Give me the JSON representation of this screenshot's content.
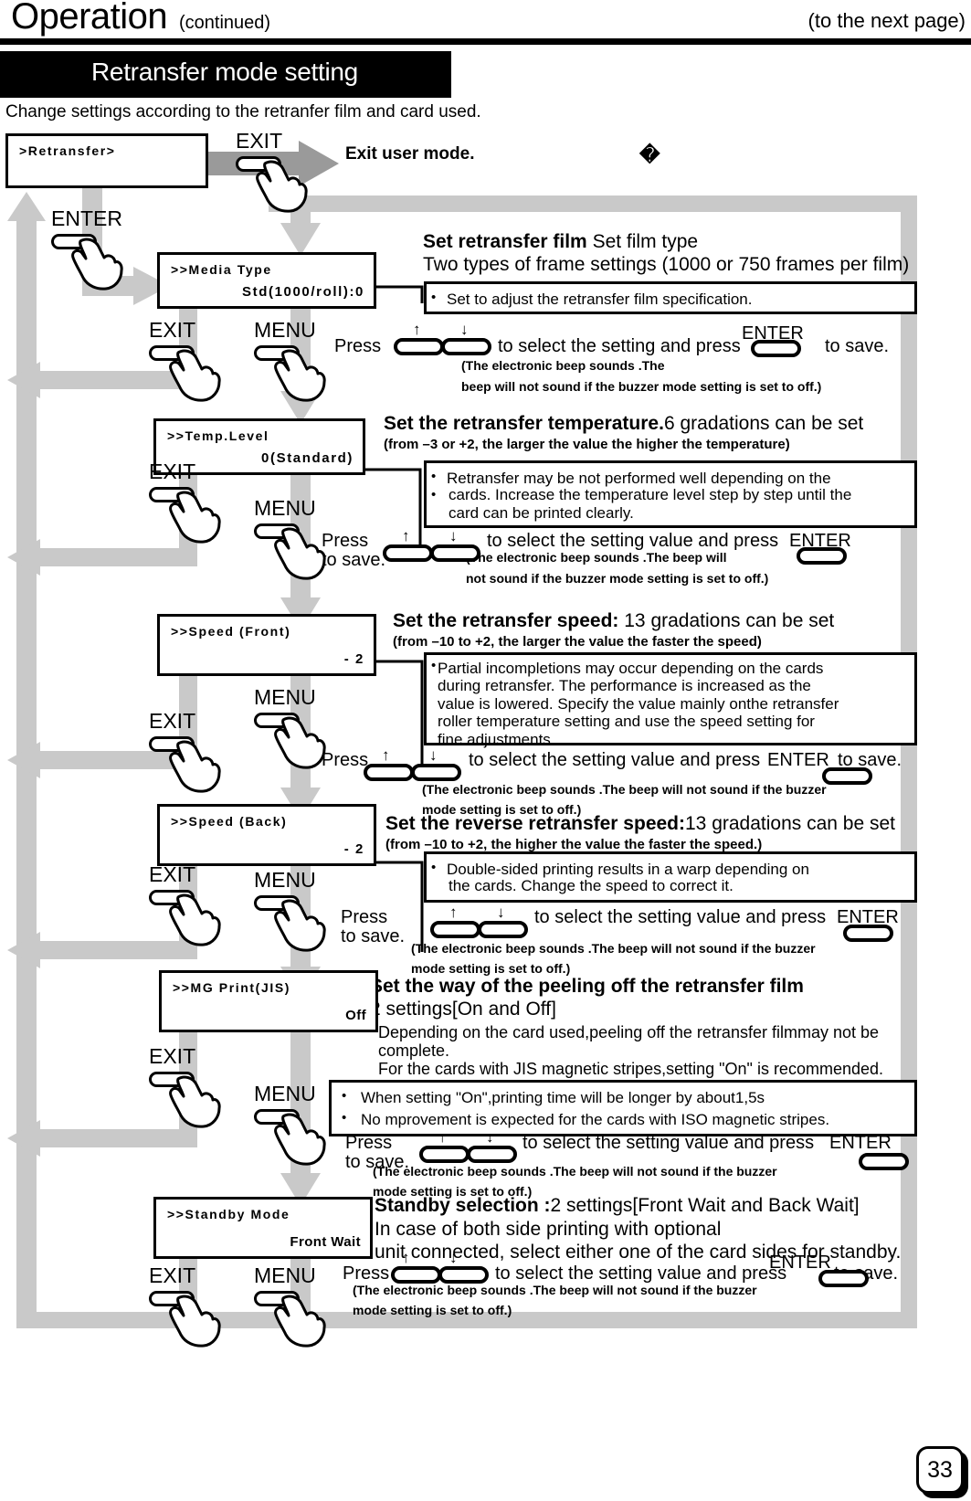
{
  "header": {
    "title": "Operation",
    "continued": "(continued)",
    "next_page": "(to the next page)",
    "section_band": "Retransfer mode setting",
    "intro": "Change settings according to the retranfer film and card used.",
    "unknown_glyph": "�"
  },
  "buttons": {
    "exit": "EXIT",
    "menu": "MENU",
    "enter": "ENTER",
    "up_arrow": "↑",
    "down_arrow": "↓"
  },
  "exit_flow": {
    "lcd_line1": ">Retransfer>",
    "label": "Exit user mode.",
    "exit_label": "EXIT"
  },
  "common": {
    "beep_full_1": "(The electronic beep sounds .The",
    "beep_full_2": "beep will not sound if the buzzer mode setting is set to off.)",
    "beep_a1": "(The electronic beep sounds .The beep will",
    "beep_a2": "not sound if the buzzer mode setting is set to off.)",
    "beep_b1": "(The electronic beep sounds .The beep will not sound if the buzzer",
    "beep_b2": "mode setting is set to off.)",
    "press": "Press",
    "to_save": "to save.",
    "select_setting_and_press": "to select the setting and press",
    "select_value_and_press": "to select the setting value and press"
  },
  "steps": [
    {
      "id": "media-type",
      "lcd_line1": ">>Media Type",
      "lcd_line2": "Std(1000/roll):0",
      "title_bold": "Set retransfer film",
      "title_rest": " Set film type",
      "title_line2": "Two types of frame settings (1000 or 750 frames per film)",
      "notes": [
        "Set to adjust the retransfer film specification."
      ]
    },
    {
      "id": "temp-level",
      "lcd_line1": ">>Temp.Level",
      "lcd_line2": "0(Standard)",
      "title_bold": "Set the retransfer temperature.",
      "title_rest": "6 gradations can be set",
      "title_line2": "(from –3 or +2, the larger the value the higher the temperature)",
      "notes": [
        "Retransfer may be not performed well depending on the",
        "cards.  Increase the temperature level step by step until the",
        "card can be printed clearly."
      ]
    },
    {
      "id": "speed-front",
      "lcd_line1": ">>Speed (Front)",
      "lcd_line2": "- 2",
      "title_bold": "Set the retransfer speed:",
      "title_rest": " 13 gradations can be set",
      "title_line2": "(from –10 to +2, the larger the value the faster the speed)",
      "notes": [
        "Partial incompletions may occur depending on the cards",
        "during retransfer. The performance is increased as the",
        "value is lowered.  Specify the value mainly onthe retransfer",
        "roller temperature setting and use the speed setting for",
        "fine adjustments."
      ]
    },
    {
      "id": "speed-back",
      "lcd_line1": ">>Speed (Back)",
      "lcd_line2": "- 2",
      "title_bold": "Set the reverse retransfer speed:",
      "title_rest": "13 gradations can be set",
      "title_line2": "(from –10 to +2, the higher the value the faster the speed.)",
      "notes": [
        "Double-sided printing results in a warp depending on",
        "the cards.  Change the speed to correct it."
      ]
    },
    {
      "id": "mg-print",
      "lcd_line1": ">>MG Print(JIS)",
      "lcd_line2": "Off",
      "title_bold": "Set the way of the peeling off the retransfer film",
      "title_rest": "",
      "title_line2": "2 settings[On and Off]",
      "body": [
        "Depending on the card used,peeling off the retransfer filmmay not be",
        "complete.",
        "For the cards with JIS magnetic stripes,setting \"On\" is recommended."
      ],
      "notes": [
        "When setting \"On\",printing time will be longer by about1,5s",
        "No mprovement is expected for the cards with ISO magnetic stripes."
      ]
    },
    {
      "id": "standby-mode",
      "lcd_line1": ">>Standby Mode",
      "lcd_line2": "Front Wait",
      "title_bold": "Standby selection :",
      "title_rest": "2 settings[Front Wait and Back Wait]",
      "title_line2": "In case of both side printing with optional",
      "title_line3": "unit connected, select either one of the card sides for standby."
    }
  ],
  "page_number": "33"
}
